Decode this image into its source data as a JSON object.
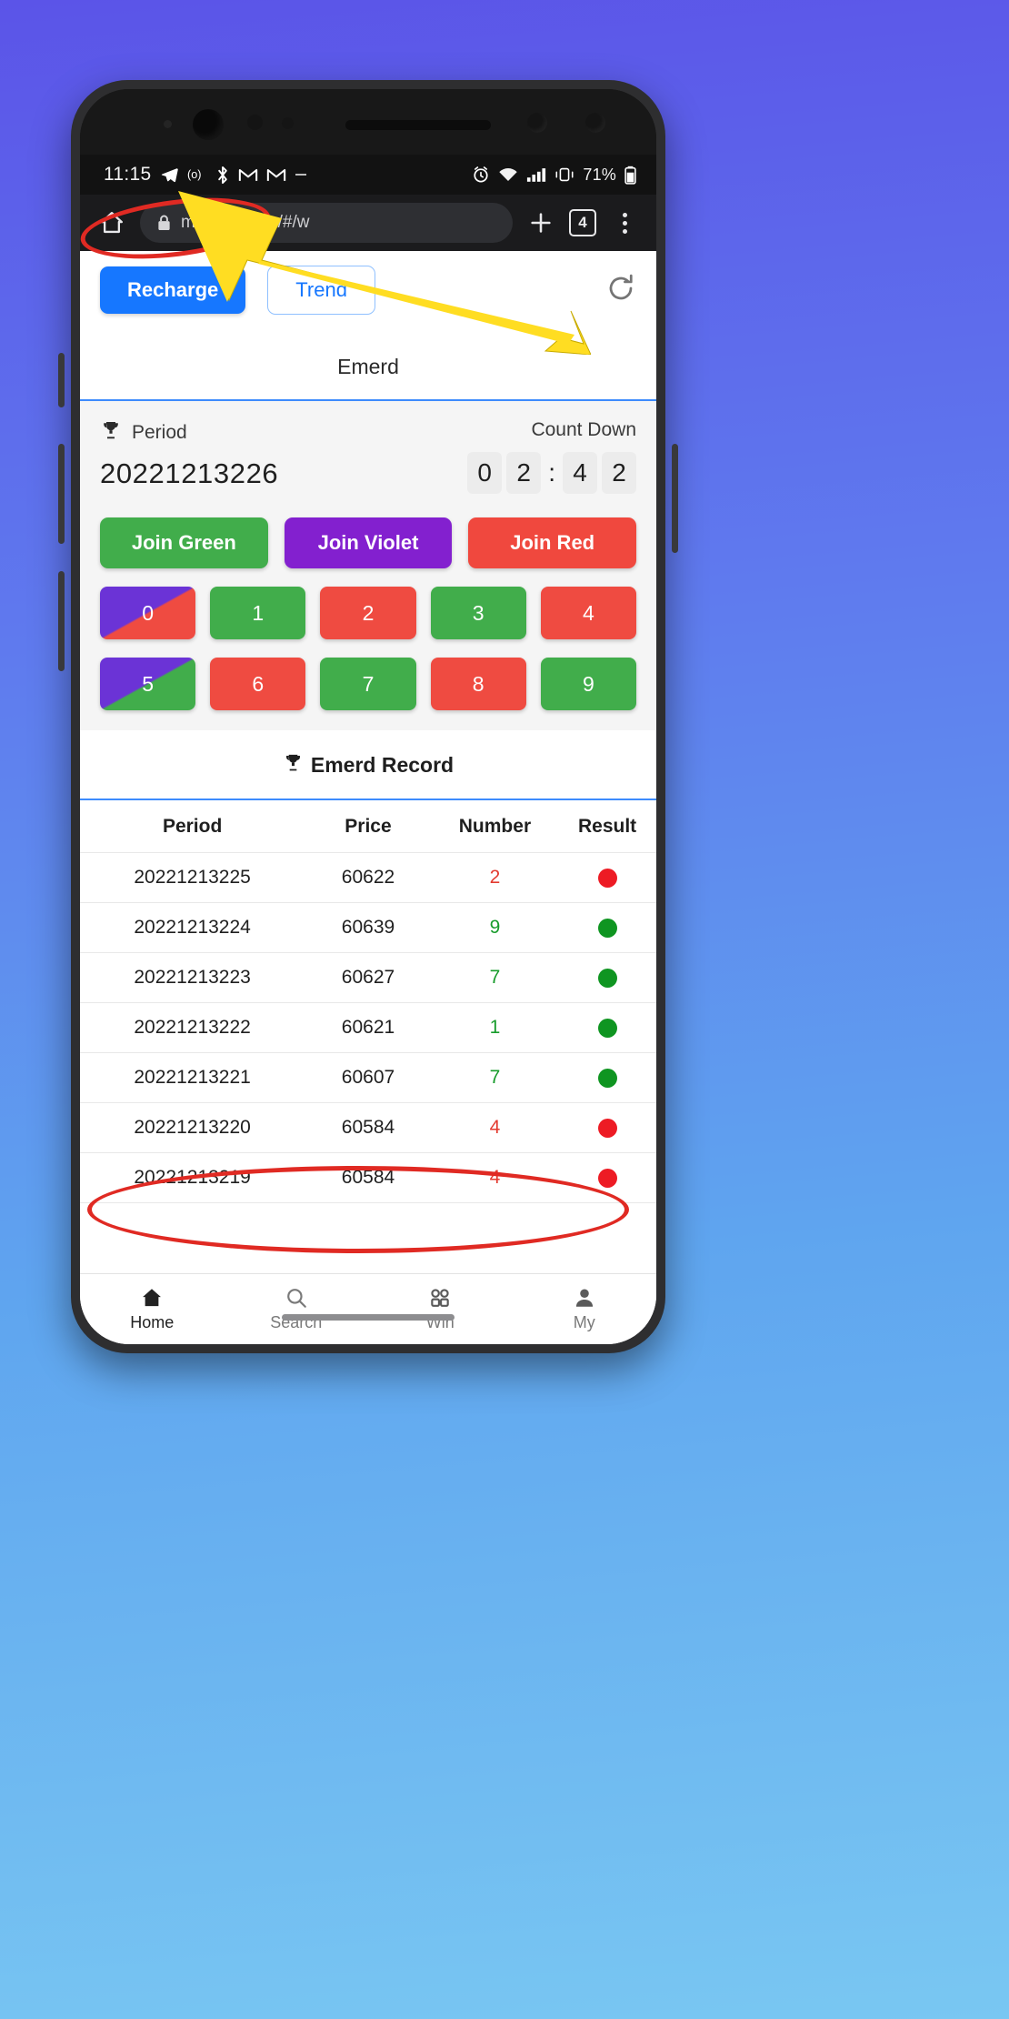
{
  "statusbar": {
    "clock": "11:15",
    "left_icons": [
      "telegram-icon",
      "opera-icon",
      "bluetooth-icon",
      "gmail-icon",
      "gmail-icon",
      "more-icon"
    ],
    "right_icons": [
      "alarm-icon",
      "wifi-icon",
      "signal-icon",
      "vibrate-icon"
    ],
    "battery_text": "71%"
  },
  "browser": {
    "home_icon": "home-icon",
    "lock_icon": "lock-icon",
    "url": "money            welry/#/w",
    "new_tab_icon": "plus-icon",
    "tab_count": "4",
    "menu_icon": "kebab-menu-icon"
  },
  "topbar": {
    "recharge_label": "Recharge",
    "trend_label": "Trend",
    "refresh_icon": "refresh-icon"
  },
  "page": {
    "game_title": "Emerd"
  },
  "play": {
    "period_icon": "trophy-icon",
    "period_label": "Period",
    "period_number": "20221213226",
    "countdown_label": "Count Down",
    "countdown": [
      "0",
      "2",
      "4",
      "2"
    ],
    "countdown_separator": ":",
    "join_buttons": [
      {
        "label": "Join Green",
        "color": "#41ad4b"
      },
      {
        "label": "Join Violet",
        "color": "#8320cf"
      },
      {
        "label": "Join Red",
        "color": "#f0483e"
      }
    ],
    "numbers": [
      {
        "label": "0",
        "style": "violet-red"
      },
      {
        "label": "1",
        "style": "green"
      },
      {
        "label": "2",
        "style": "red"
      },
      {
        "label": "3",
        "style": "green"
      },
      {
        "label": "4",
        "style": "red"
      },
      {
        "label": "5",
        "style": "violet-green"
      },
      {
        "label": "6",
        "style": "red"
      },
      {
        "label": "7",
        "style": "green"
      },
      {
        "label": "8",
        "style": "red"
      },
      {
        "label": "9",
        "style": "green"
      }
    ]
  },
  "record": {
    "icon": "trophy-icon",
    "title": "Emerd Record",
    "columns": [
      "Period",
      "Price",
      "Number",
      "Result"
    ],
    "rows": [
      {
        "period": "20221213225",
        "price": "60622",
        "number": "2",
        "number_color": "red",
        "result": "red"
      },
      {
        "period": "20221213224",
        "price": "60639",
        "number": "9",
        "number_color": "green",
        "result": "green"
      },
      {
        "period": "20221213223",
        "price": "60627",
        "number": "7",
        "number_color": "green",
        "result": "green"
      },
      {
        "period": "20221213222",
        "price": "60621",
        "number": "1",
        "number_color": "green",
        "result": "green"
      },
      {
        "period": "20221213221",
        "price": "60607",
        "number": "7",
        "number_color": "green",
        "result": "green"
      },
      {
        "period": "20221213220",
        "price": "60584",
        "number": "4",
        "number_color": "red",
        "result": "red"
      },
      {
        "period": "20221213219",
        "price": "60584",
        "number": "4",
        "number_color": "red",
        "result": "red"
      }
    ]
  },
  "tabbar": {
    "items": [
      {
        "label": "Home",
        "icon": "home-icon",
        "active": true
      },
      {
        "label": "Search",
        "icon": "search-icon",
        "active": false
      },
      {
        "label": "Win",
        "icon": "grid-icon",
        "active": false
      },
      {
        "label": "My",
        "icon": "person-icon",
        "active": false
      }
    ]
  },
  "annotations": {
    "ellipse_status_color": "#e02a23",
    "ellipse_row_color": "#e02a23",
    "arrow_color": "#ffdd22"
  }
}
